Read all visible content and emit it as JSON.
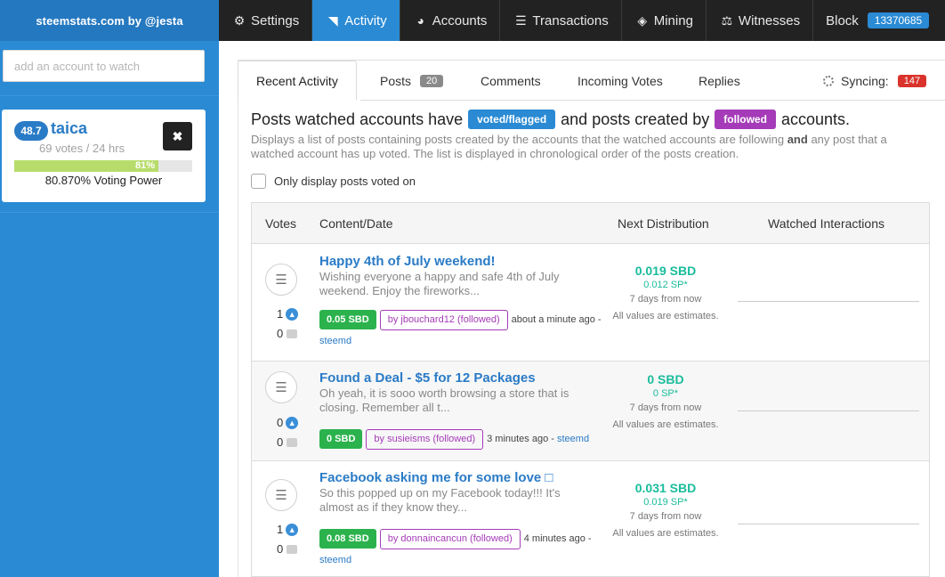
{
  "sidebar": {
    "brand": "steemstats.com by @jesta",
    "account_input_placeholder": "add an account to watch",
    "account": {
      "reputation": "48.7",
      "name": "taica",
      "votes": "69 votes / 24 hrs",
      "voting_power_fraction": 0.81,
      "voting_power_short": "81%",
      "voting_power_text": "80.870% Voting Power",
      "remove_icon": "close-icon"
    }
  },
  "nav": {
    "items": [
      {
        "label": "Settings",
        "icon": "gears-icon"
      },
      {
        "label": "Activity",
        "icon": "rss-icon"
      },
      {
        "label": "Accounts",
        "icon": "pie-chart-icon"
      },
      {
        "label": "Transactions",
        "icon": "list-icon"
      },
      {
        "label": "Mining",
        "icon": "cube-icon"
      },
      {
        "label": "Witnesses",
        "icon": "balance-scale-icon"
      }
    ],
    "block_label": "Block",
    "block_number": "13370685",
    "active_color": "#2a8ad4"
  },
  "tabs": {
    "recent_activity": "Recent Activity",
    "posts": "Posts",
    "posts_count": "20",
    "comments": "Comments",
    "incoming_votes": "Incoming Votes",
    "replies": "Replies",
    "syncing": "Syncing:",
    "syncing_count": "147"
  },
  "heading": {
    "part1": "Posts watched accounts have",
    "label1": "voted/flagged",
    "label1_color": "#2a8ad4",
    "part2": "and posts created by",
    "label2": "followed",
    "label2_color": "#a53bb8",
    "part3": "accounts."
  },
  "description": {
    "part1": "Displays a list of posts containing posts created by the accounts that the watched accounts are following",
    "bold": "and",
    "part2": "any post that a watched account has up voted. The list is displayed in chronological order of the posts creation."
  },
  "checkbox_label": "Only display posts voted on",
  "table": {
    "headers": [
      "Votes",
      "Content/Date",
      "Next Distribution",
      "Watched Interactions"
    ],
    "rows": [
      {
        "votes": "1",
        "comments": "0",
        "title": "Happy 4th of July weekend!",
        "body": "Wishing everyone a happy and safe 4th of July weekend. Enjoy the fireworks...",
        "sbd": "0.05 SBD",
        "by": "by jbouchard12 (followed)",
        "time": "about a minute ago",
        "sep": " - ",
        "link": "steemd",
        "dist_sbd": "0.019 SBD",
        "dist_sp": "0.012 SP*",
        "dist_when": "7 days from now",
        "dist_note": "All values are estimates."
      },
      {
        "votes": "0",
        "comments": "0",
        "title": "Found a Deal - $5 for 12 Packages",
        "body": "Oh yeah, it is sooo worth browsing a store that is closing. Remember all t...",
        "sbd": "0 SBD",
        "by": "by susieisms (followed)",
        "time": "3 minutes ago",
        "sep": " - ",
        "link": "steemd",
        "dist_sbd": "0 SBD",
        "dist_sp": "0 SP*",
        "dist_when": "7 days from now",
        "dist_note": "All values are estimates."
      },
      {
        "votes": "1",
        "comments": "0",
        "title": "Facebook asking me for some love □",
        "body": "So this popped up on my Facebook today!!! It's almost as if they know they...",
        "sbd": "0.08 SBD",
        "by": "by donnaincancun (followed)",
        "time": "4 minutes ago",
        "sep": " - ",
        "link": "steemd",
        "dist_sbd": "0.031 SBD",
        "dist_sp": "0.019 SP*",
        "dist_when": "7 days from now",
        "dist_note": "All values are estimates."
      }
    ]
  }
}
